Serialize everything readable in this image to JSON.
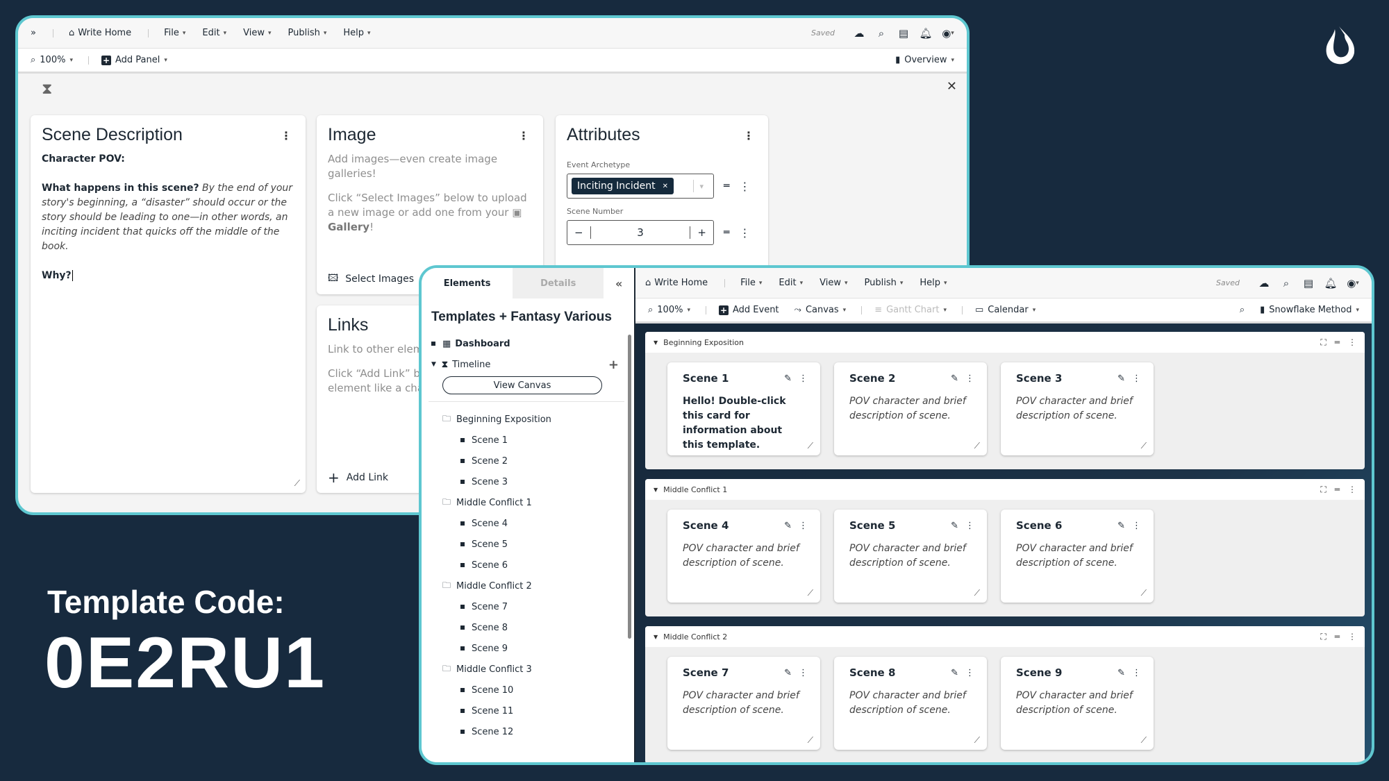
{
  "overlay": {
    "template_code_label": "Template Code:",
    "template_code": "0E2RU1"
  },
  "menu": {
    "expand_icon": "double-chevron-right-icon",
    "home": "Write Home",
    "items": [
      "File",
      "Edit",
      "View",
      "Publish",
      "Help"
    ],
    "saved": "Saved"
  },
  "window1": {
    "toolbar": {
      "zoom": "100%",
      "add_panel": "Add Panel",
      "overview": "Overview"
    },
    "scene_description": {
      "title": "Scene Description",
      "character_pov": "Character POV:",
      "question": "What happens in this scene?",
      "body": "By the end of your story's beginning, a “disaster” should occur or the story should be leading to one—in other words, an inciting incident that quicks off the middle of the book.",
      "why": "Why?"
    },
    "image": {
      "title": "Image",
      "line1": "Add images—even create image galleries!",
      "line2": "Click “Select Images” below to upload a new image or add one from your",
      "gallery": "Gallery",
      "bang": "!",
      "action": "Select Images"
    },
    "links": {
      "title": "Links",
      "line1": "Link to other elements",
      "line2": "Click “Add Link” below to link another element like a character or location.",
      "action": "Add Link"
    },
    "attributes": {
      "title": "Attributes",
      "event_archetype_label": "Event Archetype",
      "event_archetype_value": "Inciting Incident",
      "scene_number_label": "Scene Number",
      "scene_number_value": "3"
    }
  },
  "window2": {
    "sidebar": {
      "tabs": [
        "Elements",
        "Details"
      ],
      "title": "Templates + Fantasy Various",
      "dashboard": "Dashboard",
      "timeline": "Timeline",
      "view_canvas": "View Canvas",
      "folders": [
        {
          "name": "Beginning Exposition",
          "scenes": [
            "Scene 1",
            "Scene 2",
            "Scene 3"
          ]
        },
        {
          "name": "Middle Conflict 1",
          "scenes": [
            "Scene 4",
            "Scene 5",
            "Scene 6"
          ]
        },
        {
          "name": "Middle Conflict 2",
          "scenes": [
            "Scene 7",
            "Scene 8",
            "Scene 9"
          ]
        },
        {
          "name": "Middle Conflict 3",
          "scenes": [
            "Scene 10",
            "Scene 11",
            "Scene 12"
          ]
        }
      ]
    },
    "toolbar": {
      "zoom": "100%",
      "add_event": "Add Event",
      "canvas": "Canvas",
      "gantt": "Gantt Chart",
      "calendar": "Calendar",
      "method": "Snowflake Method"
    },
    "groups": [
      {
        "name": "Beginning Exposition",
        "cards": [
          {
            "title": "Scene 1",
            "desc": "Hello! Double-click this card for information about this template.",
            "bold": true
          },
          {
            "title": "Scene 2",
            "desc": "POV character and brief description of scene."
          },
          {
            "title": "Scene 3",
            "desc": "POV character and brief description of scene."
          }
        ]
      },
      {
        "name": "Middle Conflict 1",
        "cards": [
          {
            "title": "Scene 4",
            "desc": "POV character and brief description of scene."
          },
          {
            "title": "Scene 5",
            "desc": "POV character and brief description of scene."
          },
          {
            "title": "Scene 6",
            "desc": "POV character and brief description of scene."
          }
        ]
      },
      {
        "name": "Middle Conflict 2",
        "cards": [
          {
            "title": "Scene 7",
            "desc": "POV character and brief description of scene."
          },
          {
            "title": "Scene 8",
            "desc": "POV character and brief description of scene."
          },
          {
            "title": "Scene 9",
            "desc": "POV character and brief description of scene."
          }
        ]
      }
    ]
  }
}
